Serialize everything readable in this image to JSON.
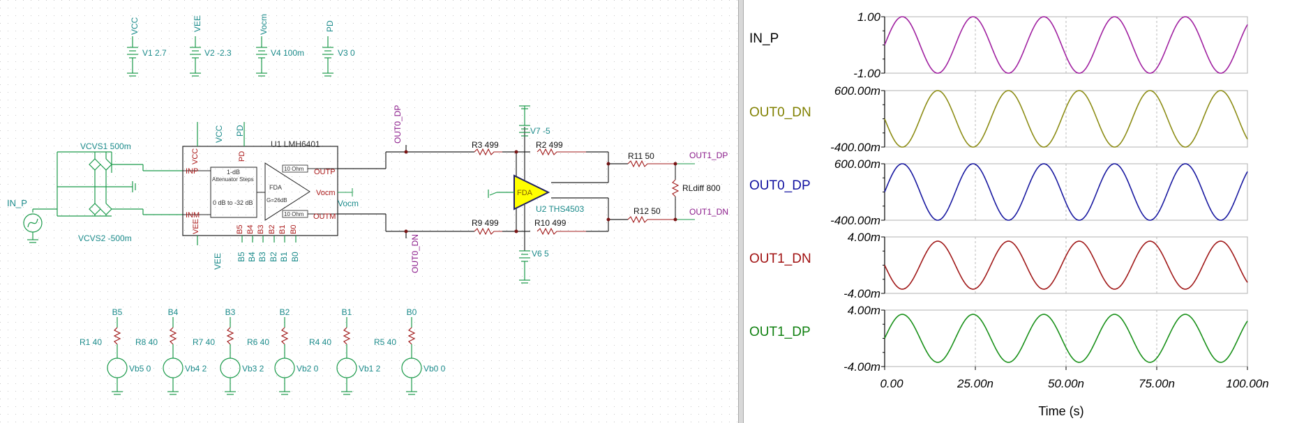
{
  "schematic": {
    "supplies": [
      {
        "node": "VCC",
        "label": "V1 2.7"
      },
      {
        "node": "VEE",
        "label": "V2 -2.3"
      },
      {
        "node": "Vocm",
        "label": "V4 100m"
      },
      {
        "node": "PD",
        "label": "V3 0"
      }
    ],
    "input_label": "IN_P",
    "vcvs1": "VCVS1 500m",
    "vcvs2": "VCVS2 -500m",
    "u1": {
      "name": "U1 LMH6401",
      "pins_top": [
        "VCC",
        "PD"
      ],
      "pin_inp": "INP",
      "pin_inm": "INM",
      "pin_outp": "OUTP",
      "pin_outm": "OUTM",
      "pin_vocm": "Vocm",
      "pin_vee": "VEE",
      "bits": [
        "B5",
        "B4",
        "B3",
        "B2",
        "B1",
        "B0"
      ],
      "att_line1": "1-dB",
      "att_line2": "Attenuator Steps",
      "att_line3": "0 dB to -32 dB",
      "fda_line1": "FDA",
      "fda_line2": "G=26dB",
      "r_out_p": "10 Ohm",
      "r_out_m": "10 Ohm",
      "ext_vee": "VEE",
      "ext_bits": [
        "B5",
        "B4",
        "B3",
        "B2",
        "B1",
        "B0"
      ],
      "vocm_net": "Vocm"
    },
    "nets": {
      "out0_dp": "OUT0_DP",
      "out0_dn": "OUT0_DN",
      "out1_dp": "OUT1_DP",
      "out1_dn": "OUT1_DN"
    },
    "resistors": {
      "r3": "R3 499",
      "r2": "R2 499",
      "r9": "R9 499",
      "r10": "R10 499",
      "r11": "R11 50",
      "r12": "R12 50",
      "rldiff": "RLdiff 800"
    },
    "u2": {
      "name": "U2 THS4503",
      "body": "FDA"
    },
    "v7": "V7 -5",
    "v6": "V6 5",
    "bit_sources": [
      {
        "node": "B5",
        "r": "R1 40",
        "v": "Vb5 0"
      },
      {
        "node": "B4",
        "r": "R8 40",
        "v": "Vb4 2"
      },
      {
        "node": "B3",
        "r": "R7 40",
        "v": "Vb3 2"
      },
      {
        "node": "B2",
        "r": "R6 40",
        "v": "Vb2 0"
      },
      {
        "node": "B1",
        "r": "R4 40",
        "v": "Vb1 2"
      },
      {
        "node": "B0",
        "r": "R5 40",
        "v": "Vb0 0"
      }
    ]
  },
  "scope": {
    "traces": [
      {
        "name": "IN_P",
        "ytop": "1.00",
        "ybot": "-1.00",
        "color": "#000000",
        "wave": "#a020a0"
      },
      {
        "name": "OUT0_DN",
        "ytop": "600.00m",
        "ybot": "-400.00m",
        "color": "#808000",
        "wave": "#8c8c14"
      },
      {
        "name": "OUT0_DP",
        "ytop": "600.00m",
        "ybot": "-400.00m",
        "color": "#1010a0",
        "wave": "#1818a0"
      },
      {
        "name": "OUT1_DN",
        "ytop": "4.00m",
        "ybot": "-4.00m",
        "color": "#a01010",
        "wave": "#a01818"
      },
      {
        "name": "OUT1_DP",
        "ytop": "4.00m",
        "ybot": "-4.00m",
        "color": "#108010",
        "wave": "#189018"
      }
    ],
    "xticks": [
      "0.00",
      "25.00n",
      "50.00n",
      "75.00n",
      "100.00n"
    ],
    "xlabel": "Time (s)"
  },
  "chart_data": {
    "type": "line",
    "xlabel": "Time (s)",
    "x_unit": "s",
    "xlim": [
      0,
      1e-07
    ],
    "period_s": 1.95e-08,
    "series": [
      {
        "name": "IN_P",
        "ylim": [
          -1.0,
          1.0
        ],
        "amplitude": 1.0,
        "offset": 0,
        "phase": "rising-from-zero"
      },
      {
        "name": "OUT0_DN",
        "ylim": [
          -0.4,
          0.6
        ],
        "amplitude": 0.5,
        "offset": 0.1,
        "phase": "inverted"
      },
      {
        "name": "OUT0_DP",
        "ylim": [
          -0.4,
          0.6
        ],
        "amplitude": 0.5,
        "offset": 0.1,
        "phase": "rising-from-zero"
      },
      {
        "name": "OUT1_DN",
        "ylim": [
          -0.004,
          0.004
        ],
        "amplitude": 0.0034,
        "offset": 0,
        "phase": "inverted"
      },
      {
        "name": "OUT1_DP",
        "ylim": [
          -0.004,
          0.004
        ],
        "amplitude": 0.0034,
        "offset": 0,
        "phase": "rising-from-zero"
      }
    ]
  }
}
